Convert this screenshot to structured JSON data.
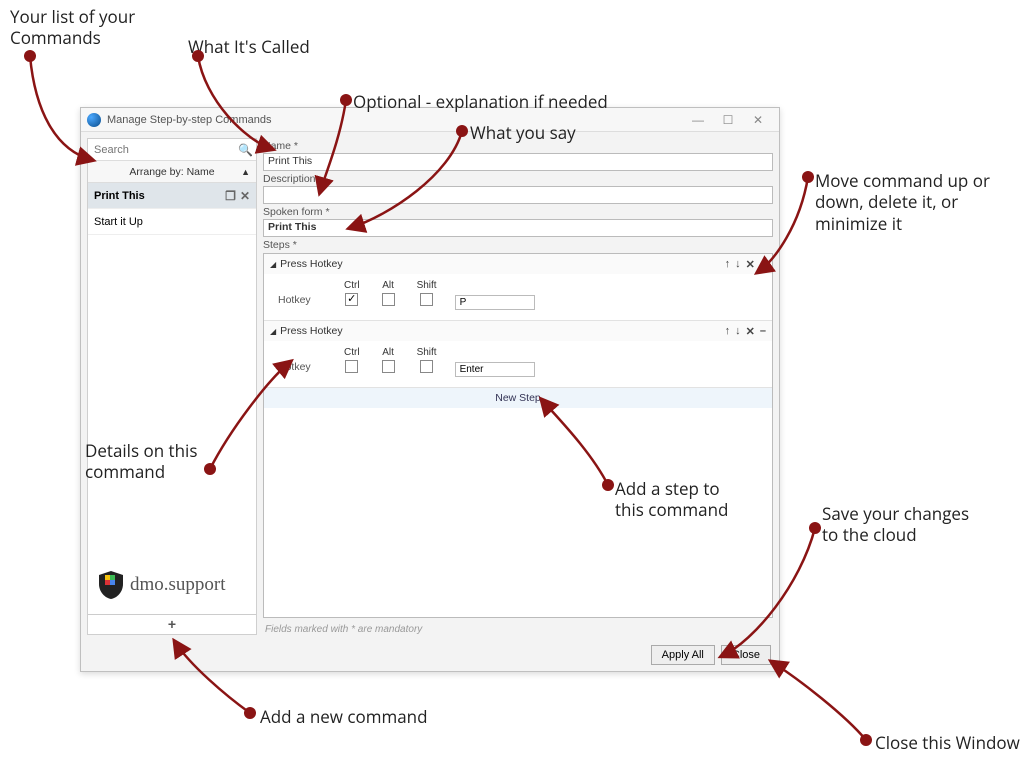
{
  "window": {
    "title": "Manage Step-by-step Commands"
  },
  "sidebar": {
    "search_placeholder": "Search",
    "arrange_label": "Arrange by: Name",
    "items": [
      {
        "label": "Print This"
      },
      {
        "label": "Start it Up"
      }
    ],
    "add_symbol": "+"
  },
  "form": {
    "name_label": "Name *",
    "name_value": "Print This",
    "description_label": "Description",
    "description_value": "",
    "spoken_label": "Spoken form *",
    "spoken_value": "Print This",
    "steps_label": "Steps *",
    "mandatory_note": "Fields marked with * are mandatory"
  },
  "steps": [
    {
      "title": "Press Hotkey",
      "hotkey_label": "Hotkey",
      "mods": {
        "ctrl": true,
        "alt": false,
        "shift": false
      },
      "mod_labels": {
        "ctrl": "Ctrl",
        "alt": "Alt",
        "shift": "Shift"
      },
      "key": "P"
    },
    {
      "title": "Press Hotkey",
      "hotkey_label": "Hotkey",
      "mods": {
        "ctrl": false,
        "alt": false,
        "shift": false
      },
      "mod_labels": {
        "ctrl": "Ctrl",
        "alt": "Alt",
        "shift": "Shift"
      },
      "key": "Enter"
    }
  ],
  "step_controls": {
    "up": "↑",
    "down": "↓",
    "delete": "✕",
    "collapse": "–"
  },
  "newstep_label": "New Step",
  "footer": {
    "apply": "Apply All",
    "close": "Close"
  },
  "annotations": {
    "list": "Your list of your\nCommands",
    "name": "What It's Called",
    "desc": "Optional - explanation if needed",
    "spoken": "What you say",
    "movecmd": "Move command up or\ndown, delete it, or\nminimize it",
    "details": "Details on this\ncommand",
    "addstep": "Add a step to\nthis command",
    "save": "Save your changes\nto the cloud",
    "addcmd": "Add a new command",
    "closewin": "Close this Window"
  },
  "watermark": "dmo.support"
}
